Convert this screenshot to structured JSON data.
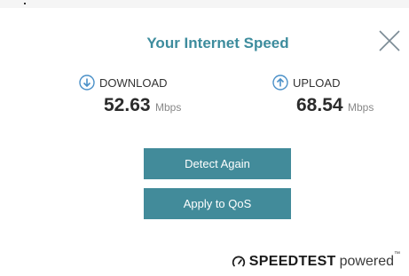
{
  "dialog": {
    "title": "Your Internet Speed",
    "close_icon": "close-x-icon"
  },
  "download": {
    "icon": "arrow-down-circle-icon",
    "label": "DOWNLOAD",
    "value": "52.63",
    "unit": "Mbps"
  },
  "upload": {
    "icon": "arrow-up-circle-icon",
    "label": "UPLOAD",
    "value": "68.54",
    "unit": "Mbps"
  },
  "actions": {
    "detect_again": "Detect Again",
    "apply_qos": "Apply to QoS"
  },
  "branding": {
    "icon": "speedtest-gauge-icon",
    "name": "SPEEDTEST",
    "suffix": "powered",
    "trademark": "™"
  },
  "colors": {
    "accent": "#428b9a",
    "title": "#3d8c9d",
    "icon_blue": "#4a90c8"
  }
}
